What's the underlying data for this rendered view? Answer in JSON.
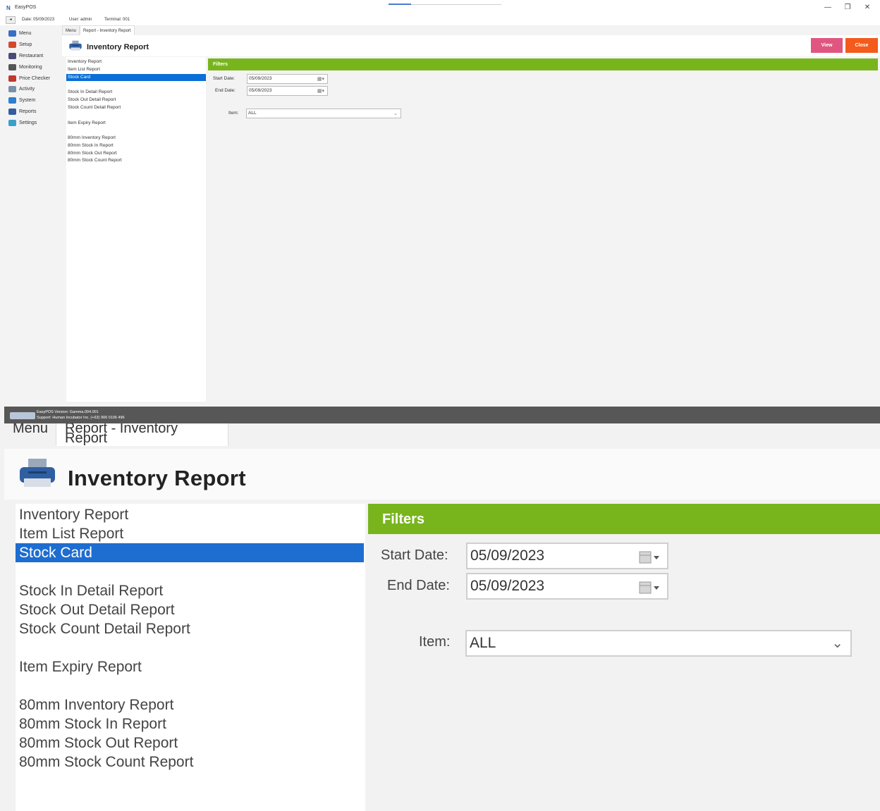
{
  "window": {
    "app_title": "EasyPOS",
    "controls": [
      "—",
      "❐",
      "✕"
    ]
  },
  "infobar": {
    "date": "Date: 05/09/2023",
    "user": "User: admin",
    "terminal": "Terminal: 001"
  },
  "sidebar": {
    "items": [
      {
        "label": "Menu",
        "icon": "menu-icon",
        "color": "#3b6fc4"
      },
      {
        "label": "Setup",
        "icon": "setup-icon",
        "color": "#d24a2b"
      },
      {
        "label": "Restaurant",
        "icon": "restaurant-icon",
        "color": "#4a4a7a"
      },
      {
        "label": "Monitoring",
        "icon": "monitoring-icon",
        "color": "#555555"
      },
      {
        "label": "Price Checker",
        "icon": "price-checker-icon",
        "color": "#c0392b"
      },
      {
        "label": "Activity",
        "icon": "activity-icon",
        "color": "#7a8fa8"
      },
      {
        "label": "System",
        "icon": "system-icon",
        "color": "#2d7fd0"
      },
      {
        "label": "Reports",
        "icon": "reports-icon",
        "color": "#2f5fa0"
      },
      {
        "label": "Settings",
        "icon": "settings-icon",
        "color": "#3aa0c8"
      }
    ]
  },
  "tabs": [
    "Menu",
    "Report - Inventory Report"
  ],
  "header": {
    "title": "Inventory Report",
    "view_label": "View",
    "close_label": "Close",
    "view_color": "#e05680",
    "close_color": "#f35a1c"
  },
  "report_list": [
    "Inventory Report",
    "Item List Report",
    "Stock Card",
    "Stock In Detail Report",
    "Stock Out Detail Report",
    "Stock Count Detail Report",
    "Item Expiry Report",
    "80mm Inventory Report",
    "80mm Stock In Report",
    "80mm Stock Out Report",
    "80mm Stock Count Report"
  ],
  "selected_report": "Stock Card",
  "filters": {
    "heading": "Filters",
    "start_date_label": "Start Date:",
    "start_date": "05/09/2023",
    "end_date_label": "End Date:",
    "end_date": "05/09/2023",
    "item_label": "Item:",
    "item_value": "ALL",
    "accent": "#78b51c"
  },
  "status": {
    "version": "EasyPOS Version: Gamma.004.001",
    "support": "Support: Human Incubator Inc. (+63) 906 0106 496"
  },
  "zoom": {
    "tab_menu": "Menu",
    "tab_report": "Report - Inventory Report"
  }
}
